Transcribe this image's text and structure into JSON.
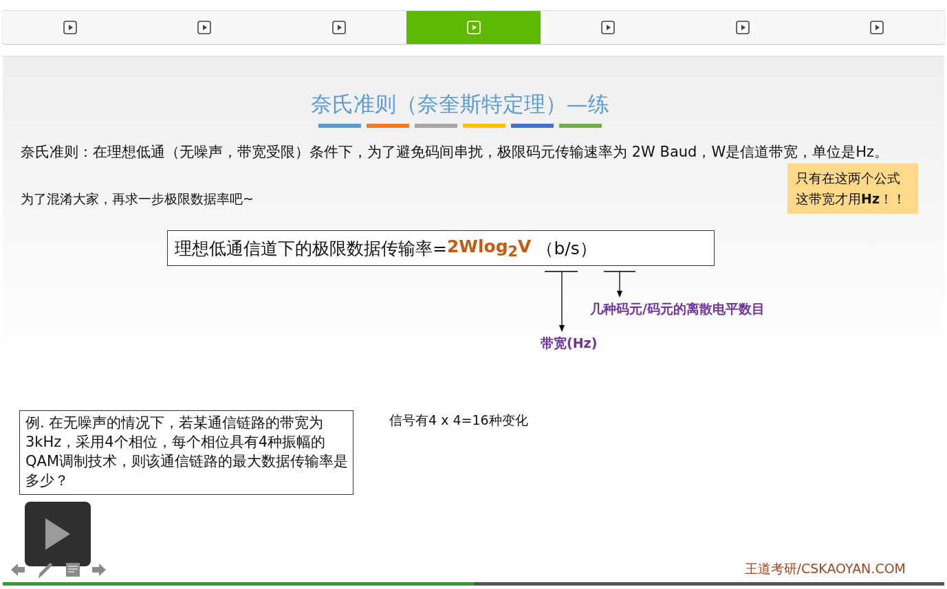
{
  "tabs": [
    {
      "selected": false
    },
    {
      "selected": false
    },
    {
      "selected": false
    },
    {
      "selected": true
    },
    {
      "selected": false
    },
    {
      "selected": false
    },
    {
      "selected": false
    }
  ],
  "slide": {
    "title": "奈氏准则（奈奎斯特定理）—练",
    "color_bars": [
      {
        "color": "#5b9bd5"
      },
      {
        "color": "#ed7d31"
      },
      {
        "color": "#a5a5a5"
      },
      {
        "color": "#ffc000"
      },
      {
        "color": "#4472c4"
      },
      {
        "color": "#70ad47"
      }
    ],
    "paragraphs": [
      "奈氏准则：在理想低通（无噪声，带宽受限）条件下，为了避免码间串扰，极限码元传输速率为 2W Baud，W是信道带宽，单位是Hz。",
      "为了混淆大家，再求一步极限数据率吧~"
    ],
    "note_lines": [
      "只有在这两个公式",
      "这带宽才用**Hz**！！"
    ],
    "formula": {
      "text": "理想低通信道下的极限数据传输率=",
      "expression": "2Wlog$_{2}$V",
      "unit": "（b/s）"
    },
    "annotations": [
      {
        "label": "几种码元/码元的离散电平数目"
      },
      {
        "label": "带宽(Hz)"
      }
    ],
    "example": "例. 在无噪声的情况下，若某通信链路的带宽为3kHz，采用4个相位，每个相位具有4种振幅的QAM调制技术，则该通信链路的最大数据传输率是多少？",
    "working": "信号有4 x 4=16种变化",
    "footer": "王道考研/CSKAOYAN.COM"
  },
  "progress": {
    "level": 0.5
  }
}
